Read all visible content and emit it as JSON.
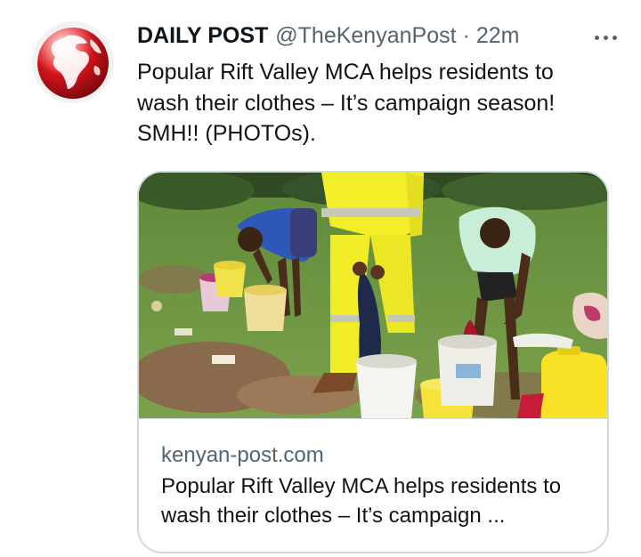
{
  "author": {
    "name": "DAILY POST",
    "handle": "@TheKenyanPost",
    "separator": "·",
    "time": "22m",
    "avatar_icon": "globe-logo"
  },
  "tweet": {
    "text": "Popular Rift Valley MCA helps residents to wash their clothes – It’s campaign season! SMH!! (PHOTOs)."
  },
  "card": {
    "domain": "kenyan-post.com",
    "title": "Popular Rift Valley MCA helps residents to wash their clothes – It’s campaign ..."
  },
  "colors": {
    "text": "#0f1419",
    "secondary": "#536471",
    "border": "#cfd9de",
    "logo_red": "#d6121b"
  }
}
